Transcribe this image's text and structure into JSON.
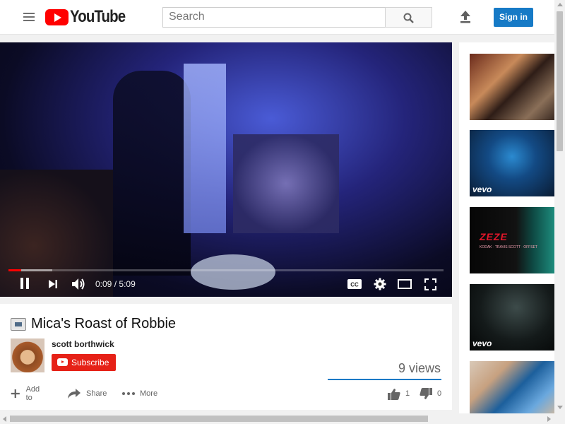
{
  "header": {
    "logo_text": "YouTube",
    "search_placeholder": "Search",
    "signin_label": "Sign in"
  },
  "player": {
    "current_time": "0:09",
    "duration": "5:09",
    "time_separator": "/",
    "progress_played_fraction": 0.029,
    "progress_buffered_fraction": 0.1
  },
  "video": {
    "title": "Mica's Roast of Robbie",
    "channel": "scott borthwick",
    "subscribe_label": "Subscribe",
    "views": "9 views",
    "likes": "1",
    "dislikes": "0",
    "actions": {
      "add_to": "Add to",
      "share": "Share",
      "more": "More"
    }
  },
  "sidebar": {
    "thumbnails": [
      {
        "badge": "",
        "overlay_title": "",
        "overlay_sub": ""
      },
      {
        "badge": "vevo",
        "overlay_title": "",
        "overlay_sub": ""
      },
      {
        "badge": "",
        "overlay_title": "ZEZE",
        "overlay_sub": "KODAK · TRAVIS SCOTT · OFFSET"
      },
      {
        "badge": "vevo",
        "overlay_title": "",
        "overlay_sub": ""
      },
      {
        "badge": "",
        "overlay_title": "",
        "overlay_sub": ""
      }
    ]
  },
  "colors": {
    "brand_red": "#ff0000",
    "signin_blue": "#167ac6",
    "subscribe_red": "#e62117"
  }
}
